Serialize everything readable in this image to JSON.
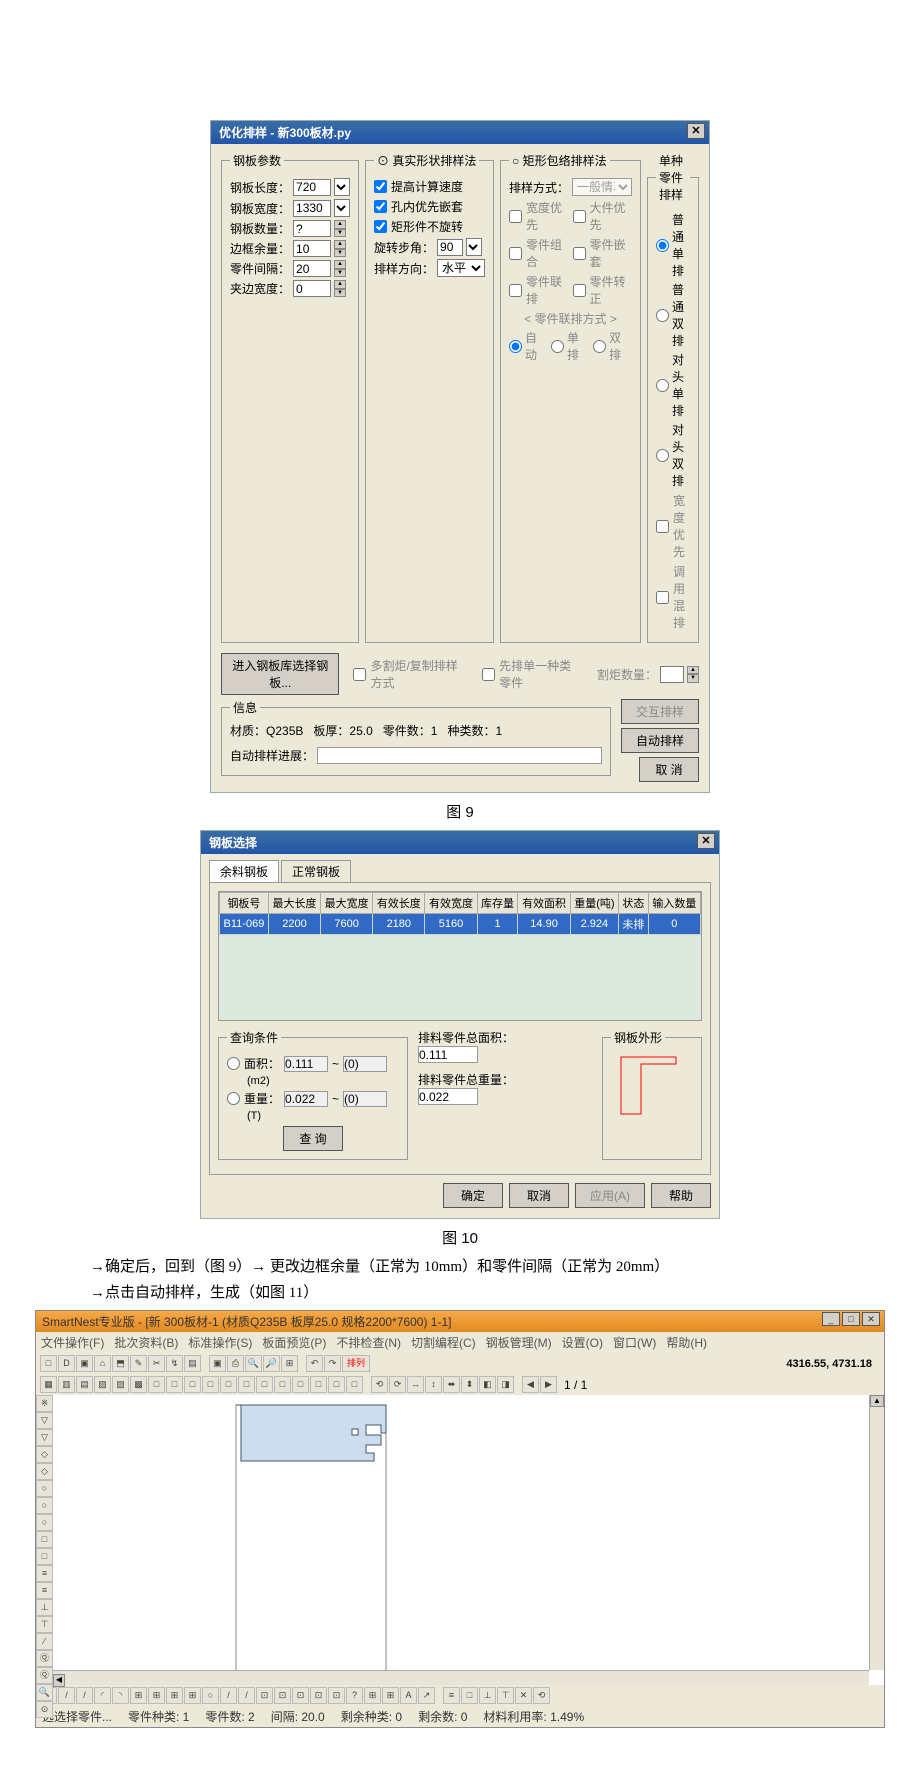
{
  "dlg9": {
    "title": "优化排样 - 新300板材.py",
    "params": {
      "legend": "钢板参数",
      "lenLabel": "钢板长度：",
      "len": "720",
      "widLabel": "钢板宽度：",
      "wid": "1330",
      "qtyLabel": "钢板数量：",
      "qty": "?",
      "marginLabel": "边框余量：",
      "margin": "10",
      "gapLabel": "零件间隔：",
      "gap": "20",
      "headLabel": "夹边宽度：",
      "head": "0"
    },
    "real": {
      "legend": "⊙ 真实形状排样法",
      "cb1": "提高计算速度",
      "cb2": "孔内优先嵌套",
      "cb3": "矩形件不旋转",
      "stepLabel": "旋转步角：",
      "step": "90",
      "dirLabel": "排样方向：",
      "dir": "水平"
    },
    "rect": {
      "legend": "○ 矩形包络排样法",
      "modeLabel": "排样方式：",
      "mode": "一般情况",
      "cb1": "宽度优先",
      "cb2": "大件优先",
      "cb3": "零件组合",
      "cb4": "零件嵌套",
      "cb5": "零件联排",
      "cb6": "零件转正",
      "linkLabel": "< 零件联排方式 >",
      "r1": "自动",
      "r2": "单排",
      "r3": "双排"
    },
    "single": {
      "legend": "单种零件排样",
      "r1": "普通单排",
      "r2": "普通双排",
      "r3": "对头单排",
      "r4": "对头双排",
      "cb1": "宽度优先",
      "cb2": "调用混排"
    },
    "enterBtn": "进入钢板库选择钢板...",
    "midcb1": "多割炬/复制排样方式",
    "midcb2": "先排单一种类零件",
    "cutLabel": "割炬数量：",
    "info": {
      "legend": "信息",
      "matLabel": "材质：",
      "mat": "Q235B",
      "thkLabel": "板厚：",
      "thk": "25.0",
      "pcsLabel": "零件数：",
      "pcs": "1",
      "typLabel": "种类数：",
      "typ": "1",
      "progLabel": "自动排样进展："
    },
    "btnInter": "交互排样",
    "btnAuto": "自动排样",
    "btnCancel": "取 消"
  },
  "cap9": "图 9",
  "dlg10": {
    "title": "钢板选择",
    "tab1": "余料钢板",
    "tab2": "正常钢板",
    "cols": [
      "钢板号",
      "最大长度",
      "最大宽度",
      "有效长度",
      "有效宽度",
      "库存量",
      "有效面积",
      "重量(吨)",
      "状态",
      "输入数量"
    ],
    "row": [
      "B11-069",
      "2200",
      "7600",
      "2180",
      "5160",
      "1",
      "14.90",
      "2.924",
      "未排",
      "0"
    ],
    "query": {
      "legend": "查询条件",
      "areaLabel": "面积：",
      "areaUnit": "(m2)",
      "area1": "0.111",
      "area2": "(0)",
      "wtLabel": "重量：",
      "wtUnit": "(T)",
      "wt1": "0.022",
      "wt2": "(0)",
      "btn": "查 询"
    },
    "sumArea": "排料零件总面积：",
    "sumAreaV": "0.111",
    "sumWt": "排料零件总重量：",
    "sumWtV": "0.022",
    "shapeLabel": "钢板外形",
    "ok": "确定",
    "cancel": "取消",
    "apply": "应用(A)",
    "help": "帮助"
  },
  "cap10": "图 10",
  "instr1": "→确定后，回到（图 9）→ 更改边框余量（正常为 10mm）和零件间隔（正常为 20mm）",
  "instr2": "→点击自动排样，生成（如图 11）",
  "app": {
    "title": "SmartNest专业版 - [新 300板材-1 (材质Q235B 板厚25.0 规格2200*7600) 1-1]",
    "menu": [
      "文件操作(F)",
      "批次资料(B)",
      "标准操作(S)",
      "板面预览(P)",
      "不排检查(N)",
      "切割编程(C)",
      "钢板管理(M)",
      "设置(O)",
      "窗口(W)",
      "帮助(H)"
    ],
    "coord": "4316.55, 4731.18",
    "page": "1 / 1",
    "status": {
      "sel": "选选择零件...",
      "pc": "零件种类: 1",
      "pn": "零件数: 2",
      "gap": "间隔: 20.0",
      "remt": "剩余种类: 0",
      "remn": "剩余数: 0",
      "util": "材料利用率: 1.49%"
    }
  }
}
